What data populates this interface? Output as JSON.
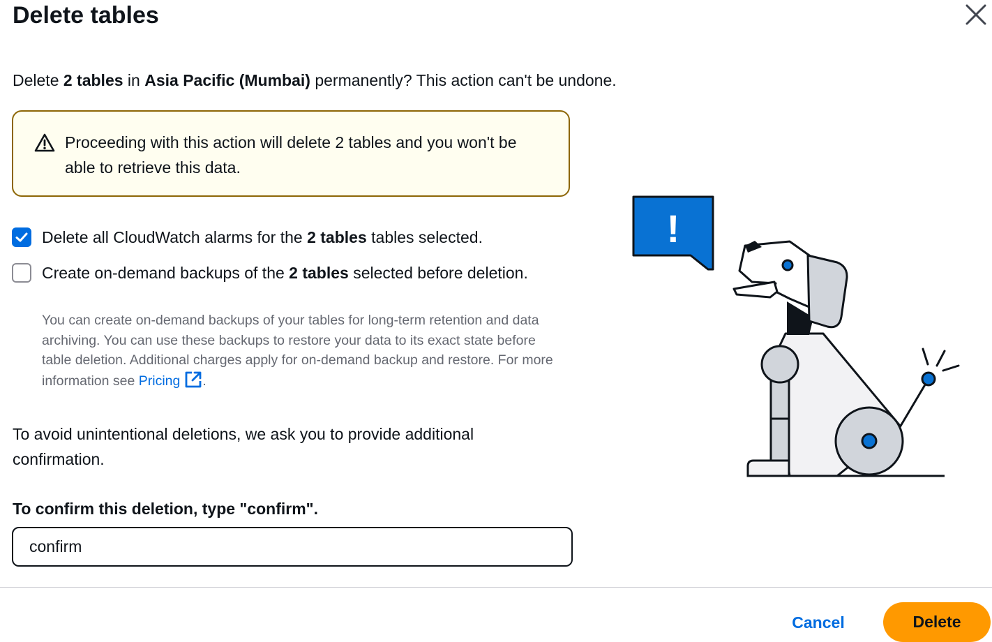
{
  "dialog": {
    "title": "Delete tables",
    "close_icon": "close-icon"
  },
  "intro": {
    "pre": "Delete ",
    "count_bold": "2 tables",
    "mid": " in ",
    "region_bold": "Asia Pacific (Mumbai)",
    "post": " permanently? This action can't be undone."
  },
  "warning": {
    "icon": "warning-triangle-icon",
    "text": "Proceeding with this action will delete 2 tables and you won't be able to retrieve this data.",
    "colors": {
      "background": "#fffef0",
      "border": "#8d6605"
    }
  },
  "options": {
    "alarms": {
      "checked": true,
      "pre": "Delete all CloudWatch alarms for the ",
      "bold": "2 tables",
      "post": " tables selected."
    },
    "backups": {
      "checked": false,
      "pre": "Create on-demand backups of the ",
      "bold": "2 tables",
      "post": " selected before deletion.",
      "description": "You can create on-demand backups of your tables for long-term retention and data archiving. You can use these backups to restore your data to its exact state before table deletion. Additional charges apply for on-demand backup and restore. For more information see ",
      "link_text": "Pricing",
      "link_icon": "external-link-icon",
      "trailing": "."
    }
  },
  "confirmation": {
    "note": "To avoid unintentional deletions, we ask you to provide additional confirmation.",
    "label": "To confirm this deletion, type \"confirm\".",
    "input_value": "confirm"
  },
  "footer": {
    "cancel_label": "Cancel",
    "delete_label": "Delete"
  },
  "illustration": {
    "icon": "robot-dog-alert-illustration",
    "bubble_glyph": "!"
  },
  "colors": {
    "accent": "#006ce0",
    "primary_button": "#ff9900",
    "text": "#0f141a",
    "secondary_text": "#656871"
  }
}
